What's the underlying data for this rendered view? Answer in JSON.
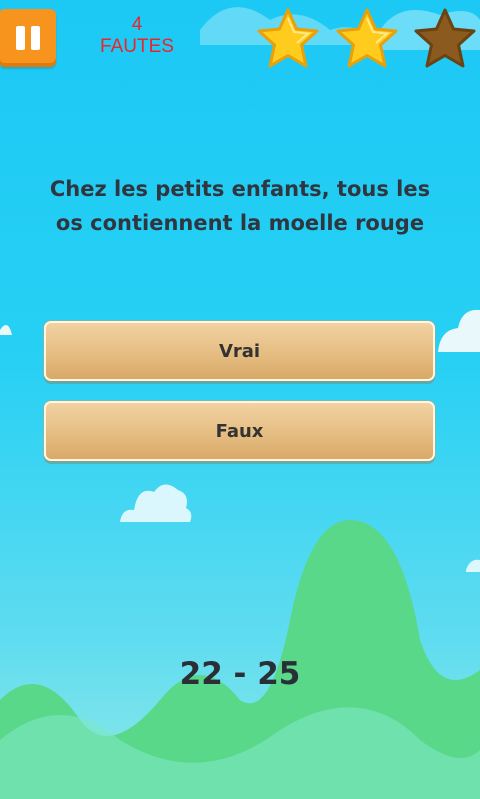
{
  "hud": {
    "fault_count": "4",
    "fault_label": "FAUTES",
    "stars": [
      {
        "state": "earned",
        "icon": "star-icon"
      },
      {
        "state": "earned",
        "icon": "star-icon"
      },
      {
        "state": "empty",
        "icon": "star-icon"
      }
    ]
  },
  "question": {
    "line1": "Chez les petits enfants, tous les",
    "line2": "os contiennent la moelle rouge"
  },
  "answers": [
    {
      "label": "Vrai"
    },
    {
      "label": "Faux"
    }
  ],
  "score": {
    "text": "22 - 25"
  },
  "colors": {
    "sky_top": "#1cc9f5",
    "hill": "#5ad889",
    "pause_button": "#f7941d",
    "fault_text": "#e8262b",
    "star_gold": "#ffcc1e",
    "star_empty": "#8b5a1e",
    "answer_button": "#e4bb7f"
  }
}
